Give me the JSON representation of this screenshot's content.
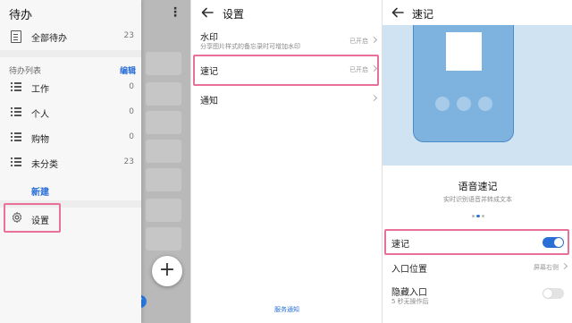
{
  "colors": {
    "accent": "#2a6fd6",
    "highlight": "#e8709a",
    "hero_bg": "#cfe3f2",
    "phone_fill": "#7fb3df"
  },
  "todo_panel": {
    "title": "待办",
    "more_icon": "more-vertical-icon",
    "all_todos": {
      "label": "全部待办",
      "count": "23",
      "icon": "document-icon"
    },
    "list_section": {
      "header": "待办列表",
      "edit_label": "编辑"
    },
    "lists": [
      {
        "label": "工作",
        "count": "0",
        "icon": "list-icon"
      },
      {
        "label": "个人",
        "count": "0",
        "icon": "list-icon"
      },
      {
        "label": "购物",
        "count": "0",
        "icon": "list-icon"
      },
      {
        "label": "未分类",
        "count": "23",
        "icon": "list-icon"
      }
    ],
    "new_label": "新建",
    "settings": {
      "label": "设置",
      "icon": "gear-icon",
      "highlighted": true
    },
    "fab_icon": "plus-icon"
  },
  "settings_panel": {
    "title": "设置",
    "back_icon": "back-arrow-icon",
    "items": [
      {
        "title": "水印",
        "subtitle": "分享图片样式的备忘录时可增加水印",
        "status": "已开启"
      },
      {
        "title": "速记",
        "subtitle": "",
        "status": "已开启",
        "highlighted": true
      },
      {
        "title": "通知",
        "subtitle": "",
        "status": ""
      }
    ],
    "footer_link": "服务通知"
  },
  "quick_note_panel": {
    "title": "速记",
    "back_icon": "back-arrow-icon",
    "feature_title": "语音速记",
    "feature_desc": "实时识别语音并转成文本",
    "pager": {
      "count": 3,
      "active": 1
    },
    "rows": [
      {
        "title": "速记",
        "type": "toggle",
        "on": true,
        "highlighted": true
      },
      {
        "title": "入口位置",
        "type": "value",
        "value": "屏幕右侧"
      },
      {
        "title": "隐藏入口",
        "subtitle": "5 秒无操作后",
        "type": "toggle",
        "on": false
      }
    ]
  }
}
